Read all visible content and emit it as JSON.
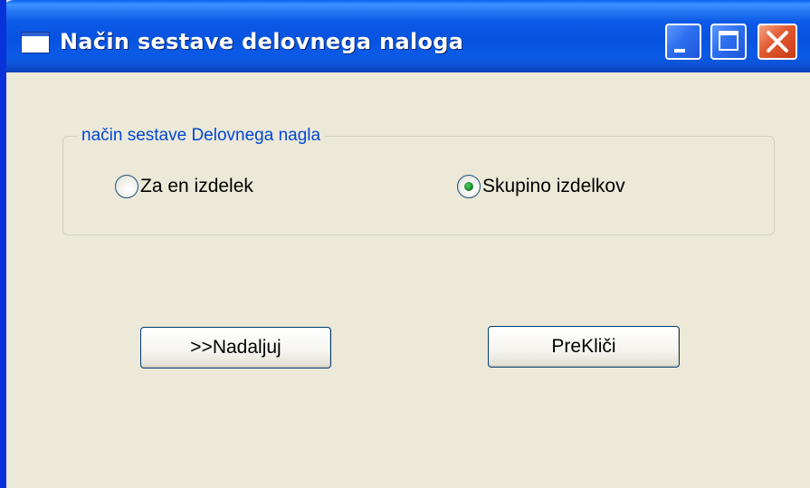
{
  "window": {
    "title": "Način sestave delovnega naloga"
  },
  "icons": {
    "app": "window-icon",
    "minimize": "minimize-icon",
    "maximize": "maximize-icon",
    "close": "close-icon"
  },
  "colors": {
    "titlebar": "#0a5ae6",
    "window_bg": "#ece9d8",
    "legend_text": "#0046d5",
    "close_button": "#e2582f"
  },
  "group": {
    "legend": "način sestave Delovnega nagla",
    "options": [
      {
        "label": "Za en izdelek",
        "selected": false
      },
      {
        "label": "Skupino izdelkov",
        "selected": true
      }
    ]
  },
  "buttons": {
    "next_label": ">>Nadaljuj",
    "cancel_label": "PreKliči"
  }
}
